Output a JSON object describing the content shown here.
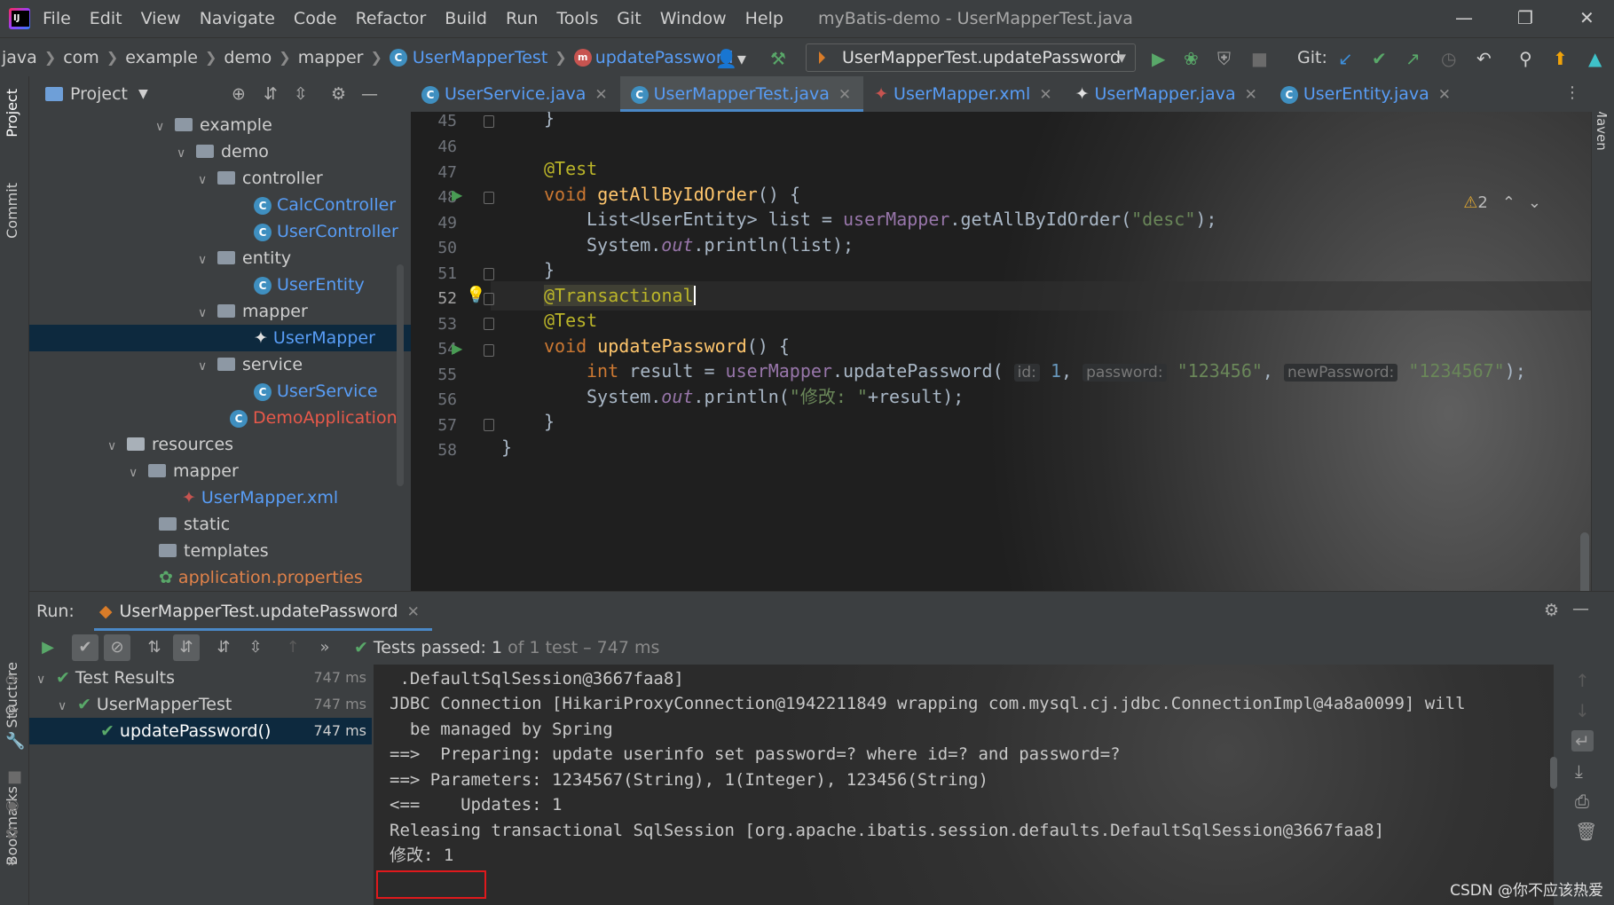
{
  "menubar": {
    "items": [
      "File",
      "Edit",
      "View",
      "Navigate",
      "Code",
      "Refactor",
      "Build",
      "Run",
      "Tools",
      "Git",
      "Window",
      "Help"
    ],
    "window_title": "myBatis-demo - UserMapperTest.java"
  },
  "breadcrumbs": [
    "java",
    "com",
    "example",
    "demo",
    "mapper",
    "UserMapperTest",
    "updatePassword"
  ],
  "toolbar": {
    "run_config": "UserMapperTest.updatePassword",
    "git_label": "Git:"
  },
  "side_tabs": {
    "project": "Project",
    "commit": "Commit",
    "structure": "Structure",
    "bookmarks": "Bookmarks",
    "maven": "Maven"
  },
  "project_panel": {
    "title": "Project",
    "tree": [
      {
        "label": "example",
        "kind": "folder",
        "depth": 0,
        "expanded": true
      },
      {
        "label": "demo",
        "kind": "folder",
        "depth": 1,
        "expanded": true
      },
      {
        "label": "controller",
        "kind": "folder",
        "depth": 2,
        "expanded": true
      },
      {
        "label": "CalcController",
        "kind": "class",
        "depth": 3
      },
      {
        "label": "UserController",
        "kind": "class",
        "depth": 3
      },
      {
        "label": "entity",
        "kind": "folder",
        "depth": 2,
        "expanded": true
      },
      {
        "label": "UserEntity",
        "kind": "class",
        "depth": 3
      },
      {
        "label": "mapper",
        "kind": "folder",
        "depth": 2,
        "expanded": true
      },
      {
        "label": "UserMapper",
        "kind": "mapper",
        "depth": 3,
        "selected": true
      },
      {
        "label": "service",
        "kind": "folder",
        "depth": 2,
        "expanded": true
      },
      {
        "label": "UserService",
        "kind": "class",
        "depth": 3
      },
      {
        "label": "DemoApplication",
        "kind": "app",
        "depth": 2
      },
      {
        "label": "resources",
        "kind": "res-folder",
        "depth": -1,
        "expanded": true
      },
      {
        "label": "mapper",
        "kind": "folder",
        "depth": 0,
        "expanded": true
      },
      {
        "label": "UserMapper.xml",
        "kind": "xml",
        "depth": 1
      },
      {
        "label": "static",
        "kind": "folder",
        "depth": 0
      },
      {
        "label": "templates",
        "kind": "folder",
        "depth": 0
      },
      {
        "label": "application.properties",
        "kind": "props",
        "depth": 0
      }
    ]
  },
  "editor": {
    "tabs": [
      {
        "label": "UserService.java",
        "active": false
      },
      {
        "label": "UserMapperTest.java",
        "active": true
      },
      {
        "label": "UserMapper.xml",
        "active": false
      },
      {
        "label": "UserMapper.java",
        "active": false
      },
      {
        "label": "UserEntity.java",
        "active": false
      }
    ],
    "warning_count": "2",
    "line_numbers": [
      "45",
      "46",
      "47",
      "48",
      "49",
      "50",
      "51",
      "52",
      "53",
      "54",
      "55",
      "56",
      "57",
      "58"
    ],
    "code": {
      "l45": "}",
      "l47_ann": "@Test",
      "l48_kw": "void",
      "l48_fn": "getAllByIdOrder",
      "l48_rest": "() {",
      "l49_a": "List<UserEntity> list = ",
      "l49_field": "userMapper",
      "l49_b": ".getAllByIdOrder(",
      "l49_str": "\"desc\"",
      "l49_c": ");",
      "l50_a": "System.",
      "l50_out": "out",
      "l50_b": ".println(list);",
      "l51": "}",
      "l52_ann": "@Transactional",
      "l53_ann": "@Test",
      "l54_kw": "void",
      "l54_fn": "updatePassword",
      "l54_rest": "() {",
      "l55_kw": "int",
      "l55_a": " result = ",
      "l55_field": "userMapper",
      "l55_b": ".updatePassword(",
      "l55_hint_id": "id:",
      "l55_num": "1",
      "l55_hint_pw": "password:",
      "l55_str1": "\"123456\"",
      "l55_hint_np": "newPassword:",
      "l55_str2": "\"1234567\"",
      "l55_c": ");",
      "l56_a": "System.",
      "l56_out": "out",
      "l56_b": ".println(",
      "l56_str": "\"修改: \"",
      "l56_c": "+result);",
      "l57": "}",
      "l58": "}"
    }
  },
  "run_panel": {
    "label": "Run:",
    "tab": "UserMapperTest.updatePassword",
    "status_passed": "Tests passed:",
    "status_count": "1",
    "status_rest": "of 1 test – 747 ms",
    "tree": [
      {
        "label": "Test Results",
        "time": "747 ms"
      },
      {
        "label": "UserMapperTest",
        "time": "747 ms"
      },
      {
        "label": "updatePassword()",
        "time": "747 ms"
      }
    ],
    "console": [
      " .DefaultSqlSession@3667faa8]",
      "JDBC Connection [HikariProxyConnection@1942211849 wrapping com.mysql.cj.jdbc.ConnectionImpl@4a8a0099] will",
      "  be managed by Spring",
      "==>  Preparing: update userinfo set password=? where id=? and password=?",
      "==> Parameters: 1234567(String), 1(Integer), 123456(String)",
      "<==    Updates: 1",
      "Releasing transactional SqlSession [org.apache.ibatis.session.defaults.DefaultSqlSession@3667faa8]",
      "修改: 1"
    ]
  },
  "watermark": "CSDN @你不应该热爱"
}
